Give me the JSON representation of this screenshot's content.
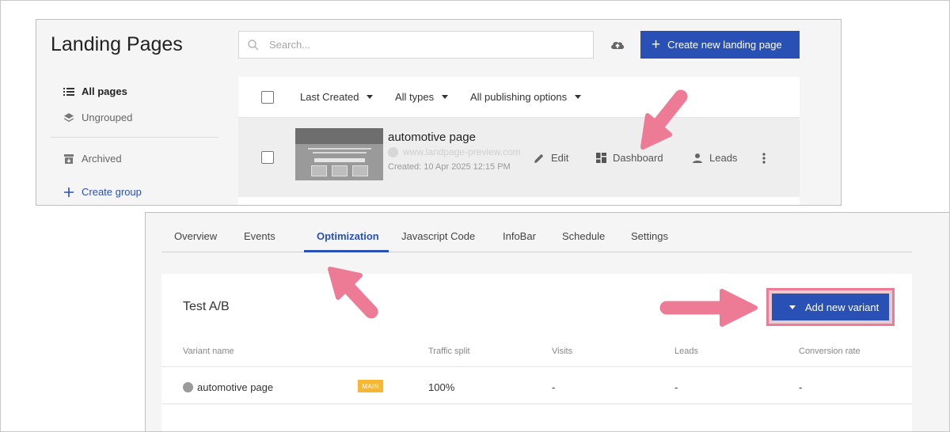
{
  "landing": {
    "title": "Landing Pages",
    "search_placeholder": "Search...",
    "upload_icon": "cloud-upload-icon",
    "create_button": "Create new landing page",
    "nav": {
      "all_pages": "All pages",
      "ungrouped": "Ungrouped",
      "archived": "Archived",
      "create_group": "Create group"
    },
    "filters": {
      "sort": "Last Created",
      "types": "All types",
      "publishing": "All publishing options"
    },
    "page_row": {
      "name": "automotive page",
      "url": "www.landpage-preview.com",
      "created": "Created: 10 Apr 2025 12:15 PM",
      "actions": {
        "edit": "Edit",
        "dashboard": "Dashboard",
        "leads": "Leads"
      }
    }
  },
  "dashboard": {
    "tabs": [
      "Overview",
      "Events",
      "Optimization",
      "Javascript Code",
      "InfoBar",
      "Schedule",
      "Settings"
    ],
    "active_tab": "Optimization",
    "section_title": "Test A/B",
    "add_variant_button": "Add new variant",
    "table": {
      "headers": [
        "Variant name",
        "Traffic split",
        "Visits",
        "Leads",
        "Conversion rate"
      ],
      "rows": [
        {
          "name": "automotive page",
          "badge": "MAIN",
          "traffic": "100%",
          "visits": "-",
          "leads": "-",
          "conversion": "-"
        }
      ]
    }
  },
  "colors": {
    "primary": "#2951b5",
    "badge": "#f7b733",
    "arrow": "#ee7b95"
  }
}
